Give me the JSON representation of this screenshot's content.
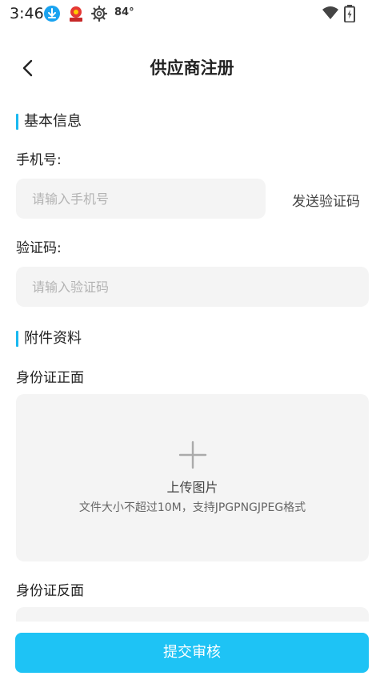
{
  "status_bar": {
    "time": "3:46",
    "temperature": "84°",
    "icons": [
      "download-icon",
      "app-notification-icon",
      "settings-gear-icon",
      "wifi-icon",
      "battery-charging-icon"
    ]
  },
  "header": {
    "title": "供应商注册",
    "back_icon": "chevron-left-icon"
  },
  "sections": {
    "basic_info": "基本信息",
    "attachments": "附件资料"
  },
  "fields": {
    "phone": {
      "label": "手机号:",
      "placeholder": "请输入手机号",
      "value": ""
    },
    "send_code_label": "发送验证码",
    "code": {
      "label": "验证码:",
      "placeholder": "请输入验证码",
      "value": ""
    }
  },
  "uploads": {
    "id_front": {
      "label": "身份证正面",
      "title": "上传图片",
      "description": "文件大小不超过10M，支持JPGPNGJPEG格式"
    },
    "id_back": {
      "label": "身份证反面"
    }
  },
  "submit_label": "提交审核",
  "colors": {
    "accent": "#1ec3f5",
    "section_marker": "#19b8f0",
    "input_bg": "#f4f4f4"
  }
}
